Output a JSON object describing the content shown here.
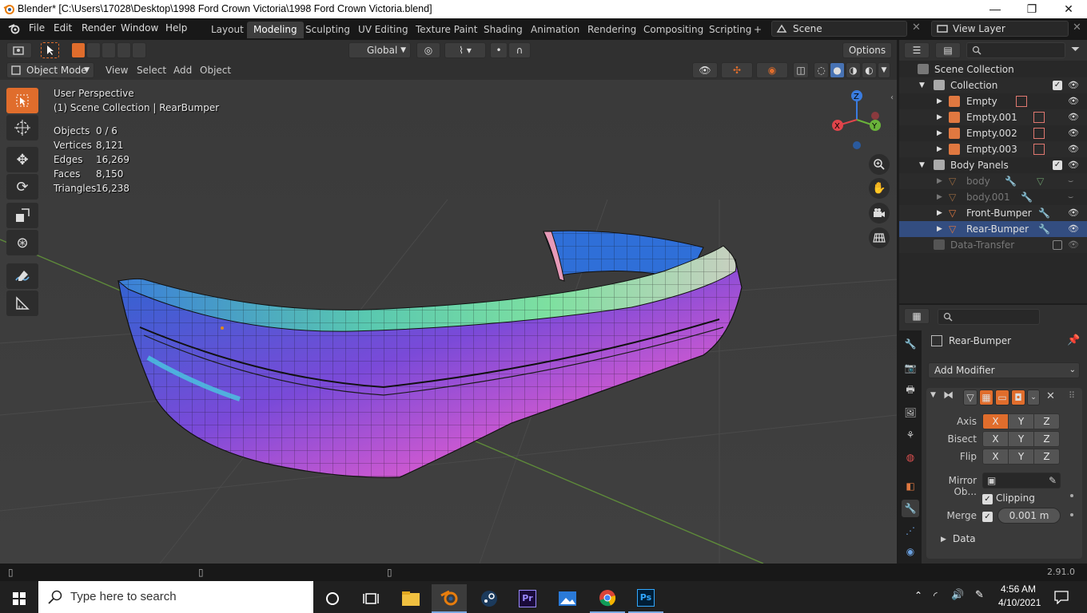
{
  "window": {
    "title": "Blender* [C:\\Users\\17028\\Desktop\\1998 Ford Crown Victoria\\1998 Ford Crown Victoria.blend]",
    "controls": [
      "—",
      "❐",
      "✕"
    ]
  },
  "menu": {
    "items": [
      "File",
      "Edit",
      "Render",
      "Window",
      "Help"
    ],
    "tabs": [
      "Layout",
      "Modeling",
      "Sculpting",
      "UV Editing",
      "Texture Paint",
      "Shading",
      "Animation",
      "Rendering",
      "Compositing",
      "Scripting"
    ],
    "active_tab": "Modeling",
    "add_tab": "+",
    "scene": "Scene",
    "view_layer": "View Layer"
  },
  "viewport_header": {
    "transform_orientation": "Global",
    "options_label": "Options",
    "mode": "Object Mode",
    "menus": [
      "View",
      "Select",
      "Add",
      "Object"
    ]
  },
  "viewport": {
    "perspective": "User Perspective",
    "collection_info": "(1) Scene Collection | RearBumper",
    "stats": [
      {
        "label": "Objects",
        "value": "0 / 6"
      },
      {
        "label": "Vertices",
        "value": "8,121"
      },
      {
        "label": "Edges",
        "value": "16,269"
      },
      {
        "label": "Faces",
        "value": "8,150"
      },
      {
        "label": "Triangles",
        "value": "16,238"
      }
    ],
    "gizmo": {
      "x": "X",
      "y": "Y",
      "z": "Z"
    }
  },
  "outliner": {
    "scene_collection": "Scene Collection",
    "collection": "Collection",
    "empties": [
      "Empty",
      "Empty.001",
      "Empty.002",
      "Empty.003"
    ],
    "body_panels": "Body Panels",
    "meshes": [
      "body",
      "body.001",
      "Front-Bumper",
      "Rear-Bumper"
    ],
    "data_transfer": "Data-Transfer"
  },
  "properties": {
    "object_name": "Rear-Bumper",
    "add_modifier": "Add Modifier",
    "axis_label": "Axis",
    "bisect_label": "Bisect",
    "flip_label": "Flip",
    "axes": [
      "X",
      "Y",
      "Z"
    ],
    "mirror_object_label": "Mirror Ob...",
    "clipping_label": "Clipping",
    "merge_label": "Merge",
    "merge_value": "0.001 m",
    "data_label": "Data"
  },
  "status": {
    "version": "2.91.0"
  },
  "taskbar": {
    "search_placeholder": "Type here to search",
    "time": "4:56 AM",
    "date": "4/10/2021"
  },
  "colors": {
    "accent_orange": "#e06d2c",
    "accent_blue": "#4772b3",
    "axis_x": "#e0444a",
    "axis_y": "#6ab33a",
    "axis_z": "#3a7ce0"
  }
}
